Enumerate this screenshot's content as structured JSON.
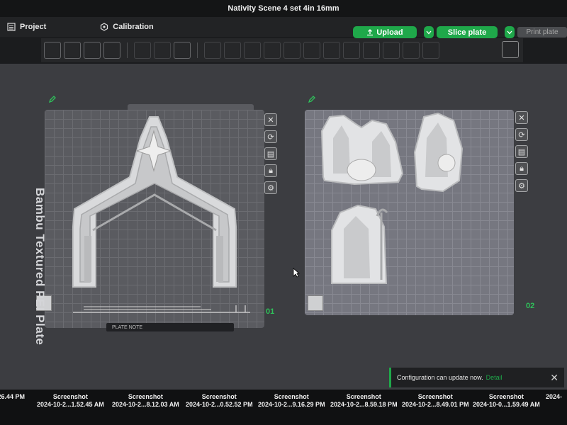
{
  "window": {
    "title": "Nativity Scene 4 set 4in 16mm"
  },
  "menu": {
    "project_label": "Project",
    "calibration_label": "Calibration"
  },
  "actions": {
    "upload_label": "Upload",
    "slice_label": "Slice plate",
    "print_label": "Print plate"
  },
  "plates": [
    {
      "name_label": "Bambu Textured PEI Plate",
      "number": "01",
      "footer_text": "PLATE NOTE"
    },
    {
      "number": "02"
    }
  ],
  "notification": {
    "message": "Configuration can update now.",
    "link": "Detail"
  },
  "desktop": {
    "screenshots": [
      {
        "label": "",
        "time": ".26.44 PM"
      },
      {
        "label": "Screenshot",
        "time": "2024-10-2...1.52.45 AM"
      },
      {
        "label": "Screenshot",
        "time": "2024-10-2...8.12.03 AM"
      },
      {
        "label": "Screenshot",
        "time": "2024-10-2...0.52.52 PM"
      },
      {
        "label": "Screenshot",
        "time": "2024-10-2...9.16.29 PM"
      },
      {
        "label": "Screenshot",
        "time": "2024-10-2...8.59.18 PM"
      },
      {
        "label": "Screenshot",
        "time": "2024-10-2...8.49.01 PM"
      },
      {
        "label": "Screenshot",
        "time": "2024-10-0...1.59.49 AM"
      },
      {
        "label": "",
        "time": "2024-"
      }
    ]
  },
  "colors": {
    "accent": "#1fa84a",
    "plate_number": "#2fc05a"
  }
}
